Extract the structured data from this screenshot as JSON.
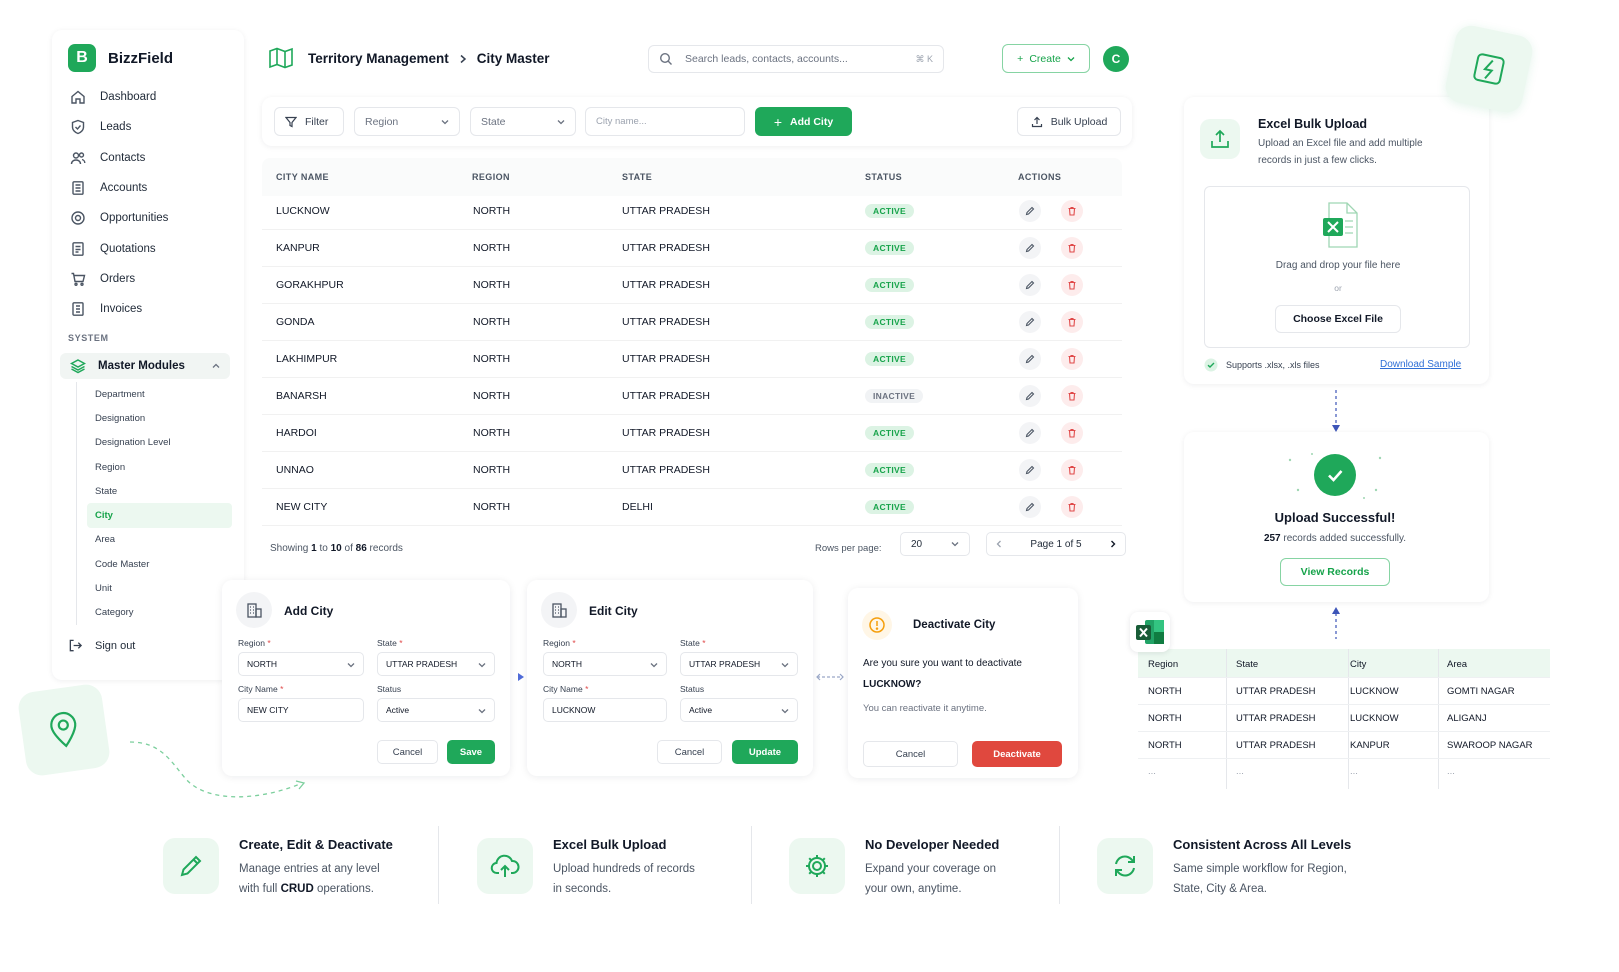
{
  "brand": {
    "logo_letter": "B",
    "name": "BizzField"
  },
  "sidebar": {
    "items": [
      {
        "label": "Dashboard",
        "icon": "home-icon"
      },
      {
        "label": "Leads",
        "icon": "shield-icon"
      },
      {
        "label": "Contacts",
        "icon": "users-icon"
      },
      {
        "label": "Accounts",
        "icon": "building-icon"
      },
      {
        "label": "Opportunities",
        "icon": "target-icon"
      },
      {
        "label": "Quotations",
        "icon": "document-icon"
      },
      {
        "label": "Orders",
        "icon": "cart-icon"
      },
      {
        "label": "Invoices",
        "icon": "invoice-icon"
      }
    ],
    "section_label": "SYSTEM",
    "master_modules": "Master Modules",
    "sub_items": [
      "Department",
      "Designation",
      "Designation Level",
      "Region",
      "State",
      "City",
      "Area",
      "Code Master",
      "Unit",
      "Category"
    ],
    "active_sub": "City",
    "sign_out": "Sign out"
  },
  "header": {
    "breadcrumb": [
      "Territory Management",
      "City Master"
    ],
    "search_placeholder": "Search leads, contacts, accounts...",
    "search_shortcut": "⌘ K",
    "create_label": "Create",
    "avatar_letter": "C"
  },
  "toolbar": {
    "filter": "Filter",
    "region_select": "Region",
    "state_select": "State",
    "city_placeholder": "City name...",
    "add_city": "Add City",
    "bulk_upload": "Bulk Upload"
  },
  "table": {
    "columns": [
      "CITY NAME",
      "REGION",
      "STATE",
      "STATUS",
      "ACTIONS"
    ],
    "rows": [
      {
        "city": "LUCKNOW",
        "region": "NORTH",
        "state": "UTTAR PRADESH",
        "status": "ACTIVE"
      },
      {
        "city": "KANPUR",
        "region": "NORTH",
        "state": "UTTAR PRADESH",
        "status": "ACTIVE"
      },
      {
        "city": "GORAKHPUR",
        "region": "NORTH",
        "state": "UTTAR PRADESH",
        "status": "ACTIVE"
      },
      {
        "city": "GONDA",
        "region": "NORTH",
        "state": "UTTAR PRADESH",
        "status": "ACTIVE"
      },
      {
        "city": "LAKHIMPUR",
        "region": "NORTH",
        "state": "UTTAR PRADESH",
        "status": "ACTIVE"
      },
      {
        "city": "BANARSH",
        "region": "NORTH",
        "state": "UTTAR PRADESH",
        "status": "INACTIVE"
      },
      {
        "city": "HARDOI",
        "region": "NORTH",
        "state": "UTTAR PRADESH",
        "status": "ACTIVE"
      },
      {
        "city": "UNNAO",
        "region": "NORTH",
        "state": "UTTAR PRADESH",
        "status": "ACTIVE"
      },
      {
        "city": "NEW CITY",
        "region": "NORTH",
        "state": "DELHI",
        "status": "ACTIVE"
      }
    ],
    "footer": {
      "prefix": "Showing",
      "from": "1",
      "to_word": "to",
      "to": "10",
      "of_word": "of",
      "total": "86",
      "suffix": "records"
    },
    "rows_per_page_label": "Rows per page:",
    "rows_per_page": "20",
    "page_label": "Page 1 of 5"
  },
  "add_modal": {
    "title": "Add City",
    "region_label": "Region",
    "region_value": "NORTH",
    "state_label": "State",
    "state_value": "UTTAR PRADESH",
    "city_label": "City Name",
    "city_value": "NEW CITY",
    "status_label": "Status",
    "status_value": "Active",
    "cancel": "Cancel",
    "save": "Save"
  },
  "edit_modal": {
    "title": "Edit City",
    "region_label": "Region",
    "region_value": "NORTH",
    "state_label": "State",
    "state_value": "UTTAR PRADESH",
    "city_label": "City Name",
    "city_value": "LUCKNOW",
    "status_label": "Status",
    "status_value": "Active",
    "cancel": "Cancel",
    "update": "Update"
  },
  "deactivate_modal": {
    "title": "Deactivate City",
    "question_line1": "Are you sure you want to deactivate",
    "question_line2": "LUCKNOW?",
    "note": "You can reactivate it anytime.",
    "cancel": "Cancel",
    "confirm": "Deactivate"
  },
  "upload_panel": {
    "title": "Excel Bulk Upload",
    "desc_line1": "Upload an Excel file and add multiple",
    "desc_line2": "records in just a few clicks.",
    "drop_text": "Drag and drop your file here",
    "or": "or",
    "choose": "Choose Excel File",
    "supports": "Supports .xlsx, .xls files",
    "sample": "Download Sample"
  },
  "success_panel": {
    "title": "Upload Successful!",
    "count": "257",
    "count_suffix": "records added successfully.",
    "view": "View Records"
  },
  "excel_grid": {
    "headers": [
      "Region",
      "State",
      "City",
      "Area"
    ],
    "rows": [
      [
        "NORTH",
        "UTTAR PRADESH",
        "LUCKNOW",
        "GOMTI NAGAR"
      ],
      [
        "NORTH",
        "UTTAR PRADESH",
        "LUCKNOW",
        "ALIGANJ"
      ],
      [
        "NORTH",
        "UTTAR PRADESH",
        "KANPUR",
        "SWAROOP NAGAR"
      ],
      [
        "...",
        "...",
        "...",
        "..."
      ]
    ]
  },
  "features": [
    {
      "title": "Create, Edit & Deactivate",
      "line1": "Manage entries at any level",
      "line2_pre": "with full",
      "line2_bold": "CRUD",
      "line2_post": "operations.",
      "icon": "pencil-icon"
    },
    {
      "title": "Excel Bulk Upload",
      "line1": "Upload hundreds of records",
      "line2_pre": "in seconds.",
      "line2_bold": "",
      "line2_post": "",
      "icon": "cloud-upload-icon"
    },
    {
      "title": "No Developer Needed",
      "line1": "Expand your coverage on",
      "line2_pre": "your own, anytime.",
      "line2_bold": "",
      "line2_post": "",
      "icon": "gear-icon"
    },
    {
      "title": "Consistent Across All Levels",
      "line1": "Same simple workflow for Region,",
      "line2_pre": "State, City & Area.",
      "line2_bold": "",
      "line2_post": "",
      "icon": "refresh-icon"
    }
  ],
  "colors": {
    "brand_green": "#1fa85a",
    "danger_red": "#e0483e",
    "active_badge_bg": "#dcf3e4"
  }
}
